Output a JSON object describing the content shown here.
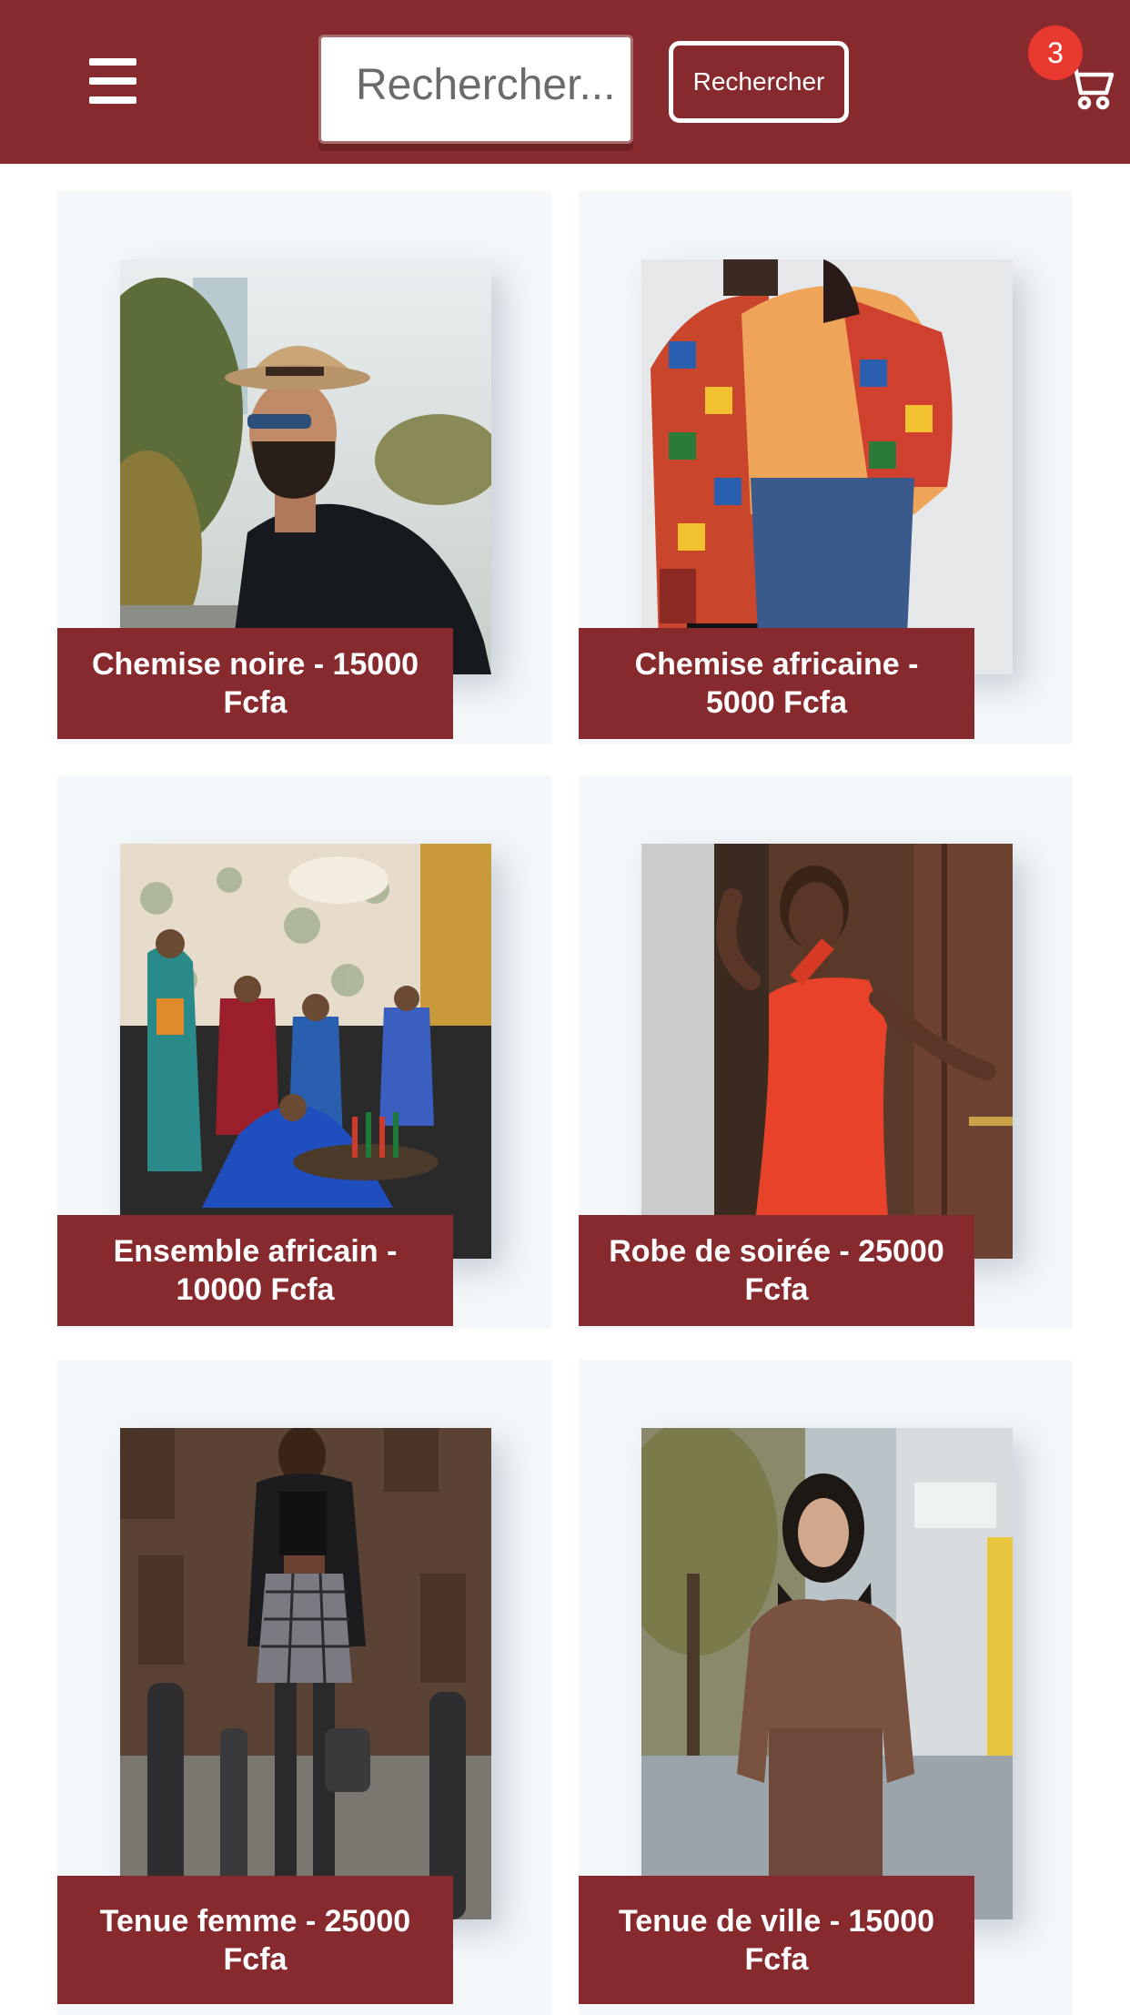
{
  "header": {
    "search_placeholder": "Rechercher...",
    "search_button_label": "Rechercher",
    "cart_count": "3",
    "colors": {
      "bar": "#872a2e",
      "badge": "#e8392f"
    }
  },
  "products": [
    {
      "label": "Chemise noire - 15000 Fcfa"
    },
    {
      "label": "Chemise africaine - 5000 Fcfa"
    },
    {
      "label": "Ensemble africain - 10000 Fcfa"
    },
    {
      "label": "Robe de soirée - 25000 Fcfa"
    },
    {
      "label": "Tenue femme - 25000 Fcfa"
    },
    {
      "label": "Tenue de ville - 15000 Fcfa"
    }
  ]
}
